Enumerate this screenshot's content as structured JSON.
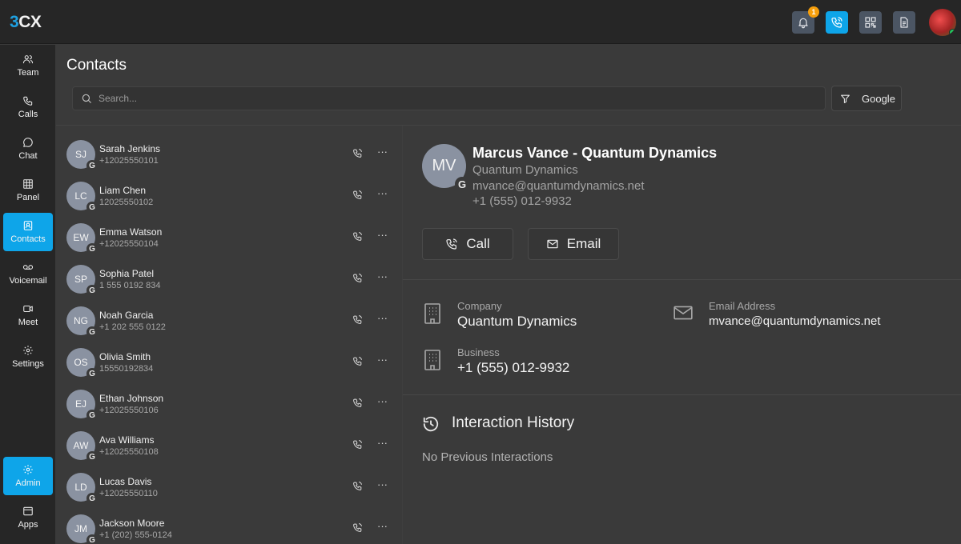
{
  "app": {
    "logo_prefix": "3",
    "logo_suffix": "CX",
    "notification_count": "1"
  },
  "sidebar": {
    "items": [
      {
        "label": "Team",
        "icon": "team-icon"
      },
      {
        "label": "Calls",
        "icon": "phone-icon"
      },
      {
        "label": "Chat",
        "icon": "chat-icon"
      },
      {
        "label": "Panel",
        "icon": "grid-icon"
      },
      {
        "label": "Contacts",
        "icon": "contact-card-icon",
        "active": true
      },
      {
        "label": "Voicemail",
        "icon": "voicemail-icon"
      },
      {
        "label": "Meet",
        "icon": "video-icon"
      },
      {
        "label": "Settings",
        "icon": "gear-icon"
      },
      {
        "label": "Admin",
        "icon": "admin-gear-icon",
        "active": true
      },
      {
        "label": "Apps",
        "icon": "apps-window-icon"
      }
    ]
  },
  "page": {
    "title": "Contacts",
    "search_placeholder": "Search...",
    "filter_label": "Google"
  },
  "contacts": [
    {
      "initials": "SJ",
      "name": "Sarah Jenkins",
      "phone": "+12025550101"
    },
    {
      "initials": "LC",
      "name": "Liam Chen",
      "phone": "12025550102"
    },
    {
      "initials": "EW",
      "name": "Emma Watson",
      "phone": "+12025550104"
    },
    {
      "initials": "SP",
      "name": "Sophia Patel",
      "phone": "1 555 0192 834"
    },
    {
      "initials": "NG",
      "name": "Noah Garcia",
      "phone": "+1 202 555 0122"
    },
    {
      "initials": "OS",
      "name": "Olivia Smith",
      "phone": "15550192834"
    },
    {
      "initials": "EJ",
      "name": "Ethan Johnson",
      "phone": "+12025550106"
    },
    {
      "initials": "AW",
      "name": "Ava Williams",
      "phone": "+12025550108"
    },
    {
      "initials": "LD",
      "name": "Lucas Davis",
      "phone": "+12025550110"
    },
    {
      "initials": "JM",
      "name": "Jackson Moore",
      "phone": "+1 (202) 555-0124"
    }
  ],
  "contact_badge": "G",
  "more_glyph": "···",
  "detail": {
    "initials": "MV",
    "name": "Marcus Vance - Quantum Dynamics",
    "company": "Quantum Dynamics",
    "email": "mvance@quantumdynamics.net",
    "phone": "+1 (555) 012-9932",
    "call_label": "Call",
    "email_label": "Email",
    "company_label": "Company",
    "company_value": "Quantum Dynamics",
    "email_address_label": "Email Address",
    "email_address_value": "mvance@quantumdynamics.net",
    "business_label": "Business",
    "business_value": "+1 (555) 012-9932",
    "history_title": "Interaction History",
    "history_empty": "No Previous Interactions"
  },
  "colors": {
    "accent": "#0ea5e9",
    "avatar_bg": "#8a92a1",
    "badge": "#f59e0b"
  }
}
